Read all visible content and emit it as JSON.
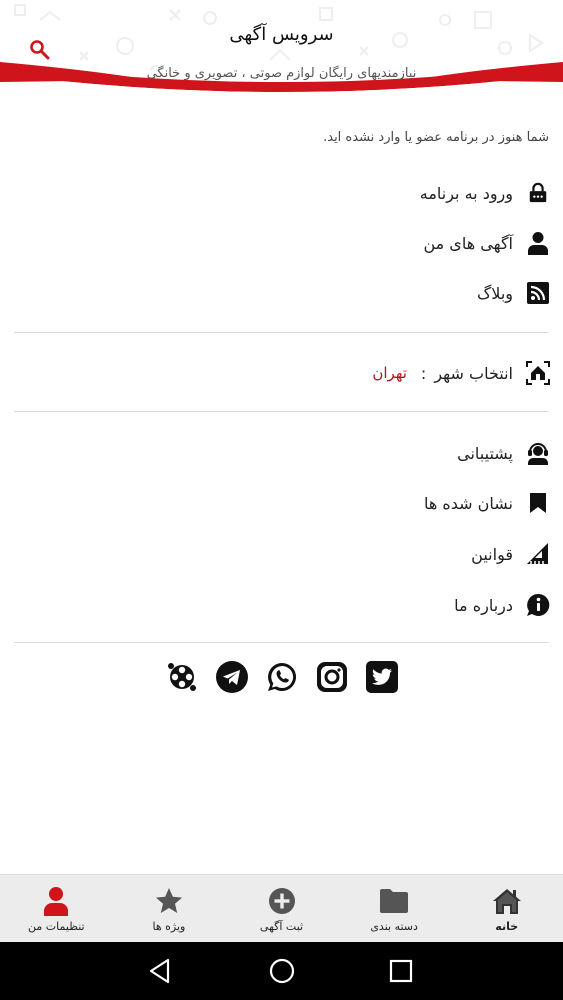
{
  "header": {
    "title": "سرویس آگهی",
    "subtitle": "نیازمندیهای رایگان لوازم صوتی ، تصویری و خانگی",
    "accent_color": "#d0141c",
    "search_icon": "search-icon"
  },
  "main": {
    "notice": "شما هنوز در برنامه عضو یا وارد نشده اید.",
    "account_items": [
      {
        "label": "ورود به برنامه",
        "icon": "lock-icon"
      },
      {
        "label": "آگهی های من",
        "icon": "user-icon"
      },
      {
        "label": "وبلاگ",
        "icon": "rss-icon"
      }
    ],
    "city": {
      "label": "انتخاب شهر",
      "colon": ":",
      "value": "تهران",
      "icon": "city-select-icon",
      "value_color": "#b4141c"
    },
    "info_items": [
      {
        "label": "پشتیبانی",
        "icon": "support-icon"
      },
      {
        "label": "نشان شده ها",
        "icon": "bookmark-icon"
      },
      {
        "label": "قوانین",
        "icon": "ruler-icon"
      },
      {
        "label": "درباره ما",
        "icon": "info-icon"
      }
    ],
    "social": [
      "twitter-icon",
      "instagram-icon",
      "whatsapp-icon",
      "telegram-icon",
      "aparat-icon"
    ]
  },
  "bottom_nav": {
    "items": [
      {
        "label": "خانه",
        "icon": "home-icon"
      },
      {
        "label": "دسته بندی",
        "icon": "folder-icon"
      },
      {
        "label": "ثبت آگهی",
        "icon": "add-circle-icon"
      },
      {
        "label": "ویژه ها",
        "icon": "star-icon"
      },
      {
        "label": "تنظیمات من",
        "icon": "user-icon",
        "active": true,
        "active_color": "#d0141c"
      }
    ]
  },
  "system_bar": {
    "buttons": [
      "back-icon",
      "home-circle-icon",
      "recents-icon"
    ]
  }
}
